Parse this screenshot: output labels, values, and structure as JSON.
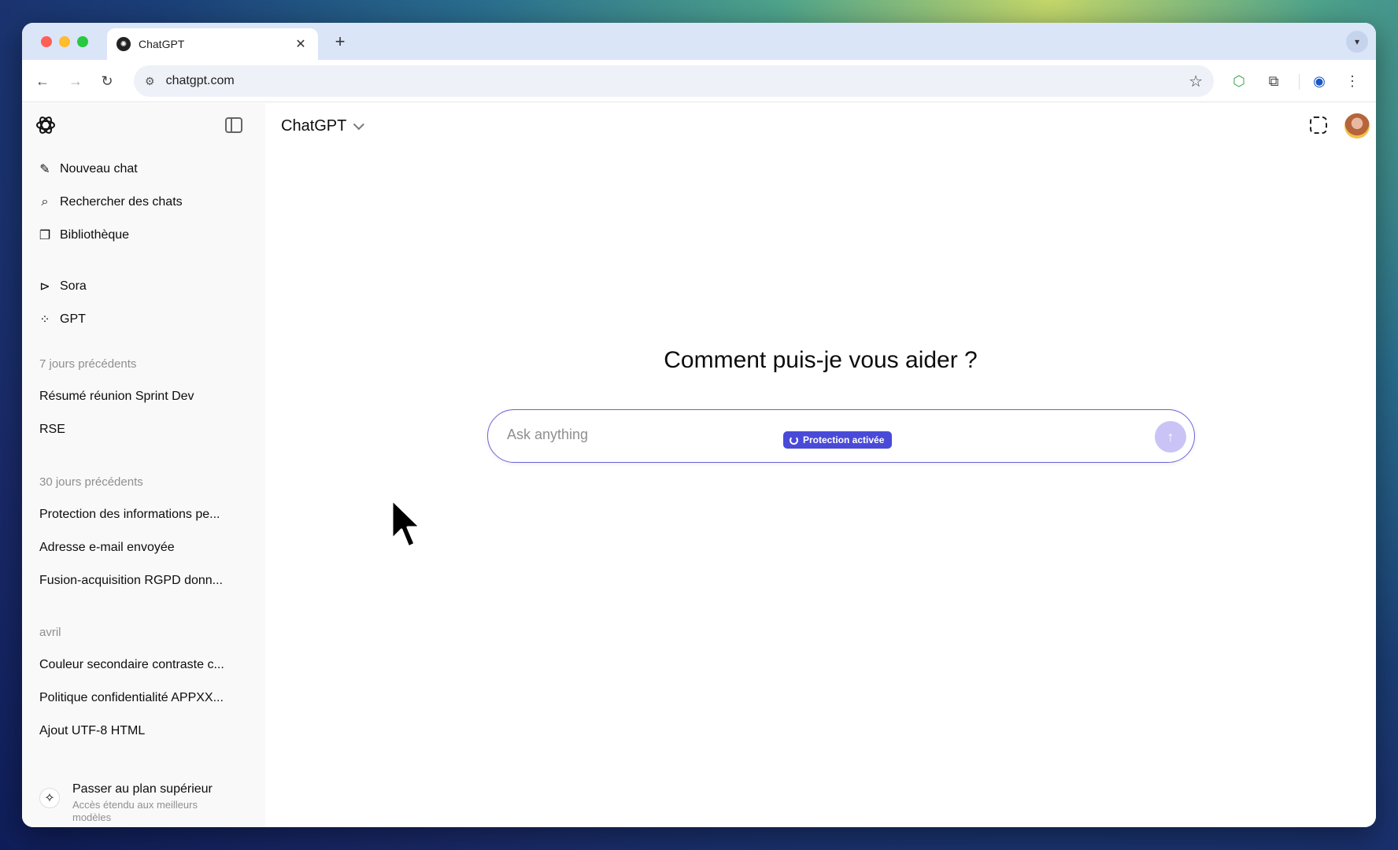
{
  "browser": {
    "tab_title": "ChatGPT",
    "url": "chatgpt.com",
    "new_tab_symbol": "+",
    "close_tab_symbol": "✕"
  },
  "sidebar": {
    "nav_items": [
      {
        "label": "Nouveau chat",
        "icon": "edit-icon"
      },
      {
        "label": "Rechercher des chats",
        "icon": "search-icon"
      },
      {
        "label": "Bibliothèque",
        "icon": "library-icon"
      }
    ],
    "app_items": [
      {
        "label": "Sora",
        "icon": "play-icon"
      },
      {
        "label": "GPT",
        "icon": "grid-icon"
      }
    ],
    "sections": [
      {
        "title": "7 jours précédents",
        "chats": [
          "Résumé réunion Sprint Dev",
          "RSE"
        ]
      },
      {
        "title": "30 jours précédents",
        "chats": [
          "Protection des informations pe...",
          "Adresse e-mail envoyée",
          "Fusion-acquisition RGPD donn..."
        ]
      },
      {
        "title": "avril",
        "chats": [
          "Couleur secondaire contraste c...",
          "Politique confidentialité APPXX...",
          "Ajout UTF-8 HTML"
        ]
      }
    ],
    "upgrade": {
      "title": "Passer au plan supérieur",
      "subtitle": "Accès étendu aux meilleurs modèles"
    }
  },
  "main": {
    "model_name": "ChatGPT",
    "headline": "Comment puis-je vous aider ?",
    "composer_placeholder": "Ask anything",
    "protection_badge": "Protection activée"
  },
  "colors": {
    "accent": "#4a4ad8",
    "composer_border": "#6b63d9",
    "send_button": "#c9c4f5"
  }
}
